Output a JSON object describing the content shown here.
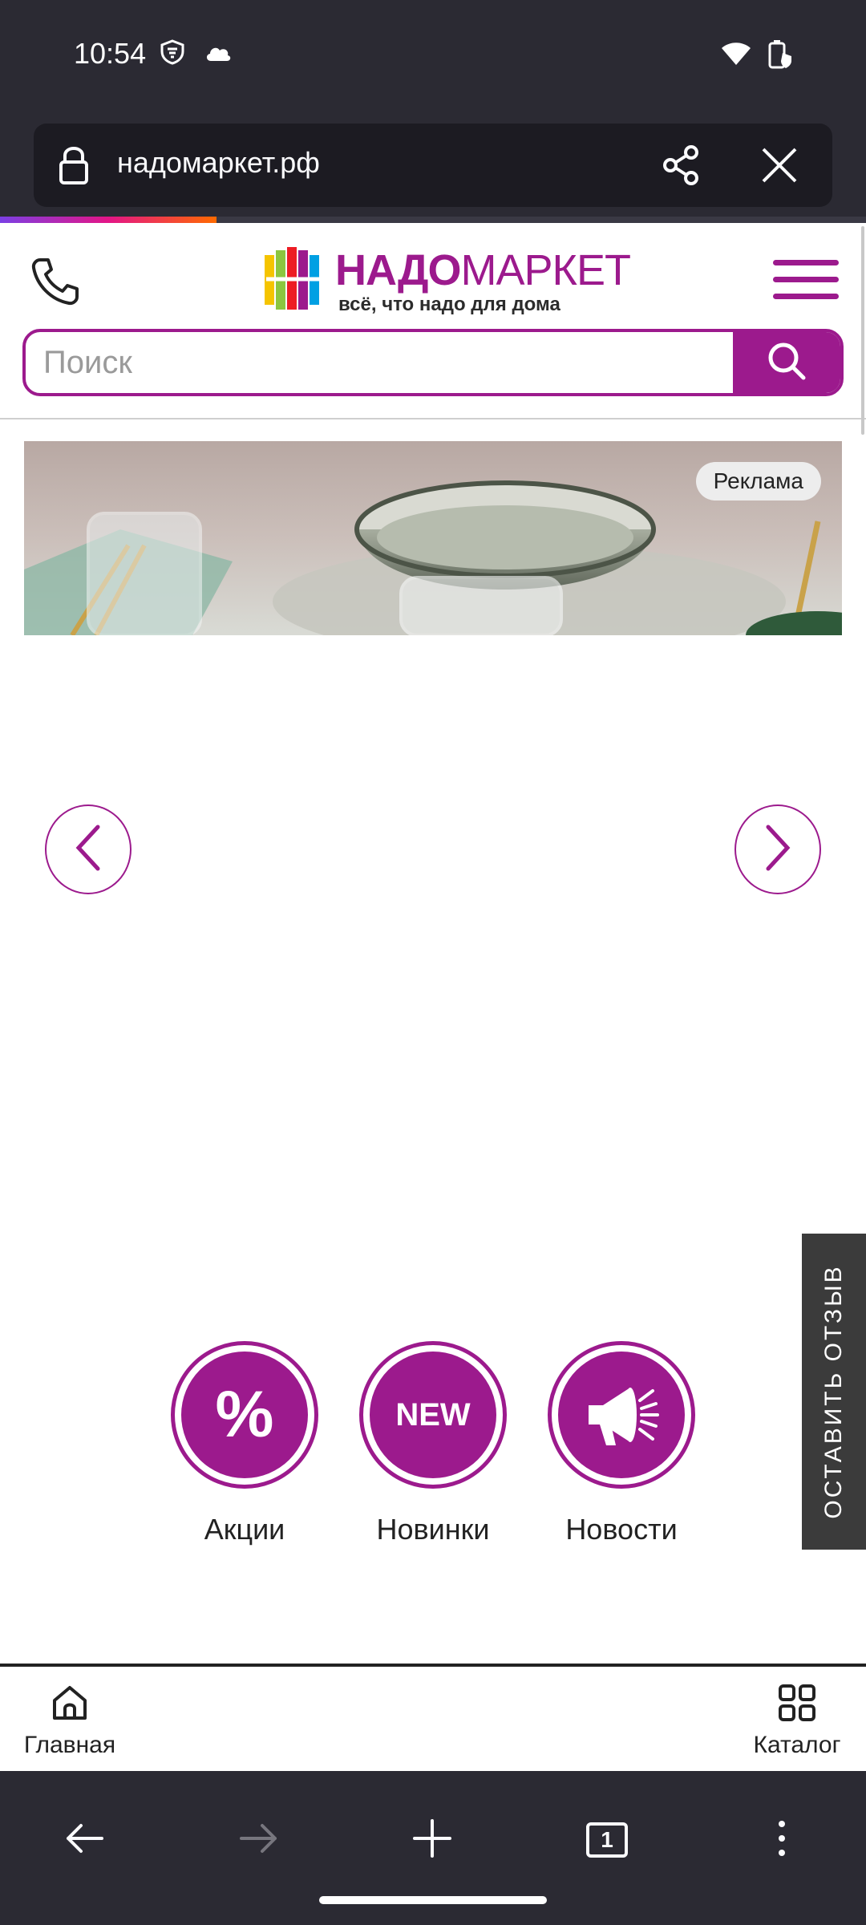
{
  "status_bar": {
    "time": "10:54"
  },
  "browser": {
    "url": "надомаркет.рф",
    "tab_count": "1",
    "load_progress": 0.25
  },
  "site": {
    "logo": {
      "name_bold": "НАДО",
      "name_light": "МАРКЕТ",
      "tagline": "всё, что надо для дома"
    },
    "search": {
      "placeholder": "Поиск"
    },
    "banner": {
      "ad_label": "Реклама"
    },
    "quick_links": [
      {
        "label": "Акции",
        "icon": "percent-icon",
        "badge": "%"
      },
      {
        "label": "Новинки",
        "icon": "new-badge-icon",
        "badge": "NEW"
      },
      {
        "label": "Новости",
        "icon": "megaphone-icon",
        "badge": ""
      }
    ],
    "feedback_tab": "ОСТАВИТЬ ОТЗЫВ",
    "bottom_nav": {
      "home": "Главная",
      "catalog": "Каталог"
    }
  },
  "colors": {
    "brand": "#9c1a8d",
    "browser_chrome": "#2b2a33"
  }
}
